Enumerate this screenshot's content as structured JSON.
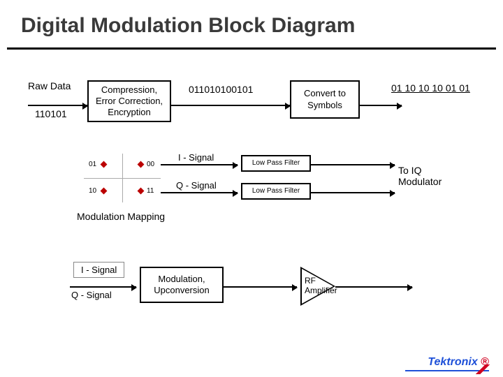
{
  "title": "Digital Modulation Block Diagram",
  "row1": {
    "raw_data_label": "Raw Data",
    "raw_data_bits": "110101",
    "block1": "Compression,\nError Correction,\nEncryption",
    "mid_bits": "011010100101",
    "block2": "Convert to\nSymbols",
    "symbols": "01 10 10 10 01 01"
  },
  "row2": {
    "i_signal": "I - Signal",
    "q_signal": "Q - Signal",
    "lpf1": "Low Pass Filter",
    "lpf2": "Low Pass Filter",
    "output": "To IQ\nModulator"
  },
  "mm": {
    "caption": "Modulation Mapping",
    "points": [
      {
        "label": "01",
        "x": 25,
        "y": 12
      },
      {
        "label": "00",
        "x": 78,
        "y": 12
      },
      {
        "label": "10",
        "x": 25,
        "y": 50
      },
      {
        "label": "11",
        "x": 78,
        "y": 50
      }
    ]
  },
  "row3": {
    "i_signal": "I - Signal",
    "q_signal": "Q - Signal",
    "block": "Modulation,\nUpconversion",
    "amp_label": "RF\nAmplifier"
  },
  "logo": "Tektronix"
}
